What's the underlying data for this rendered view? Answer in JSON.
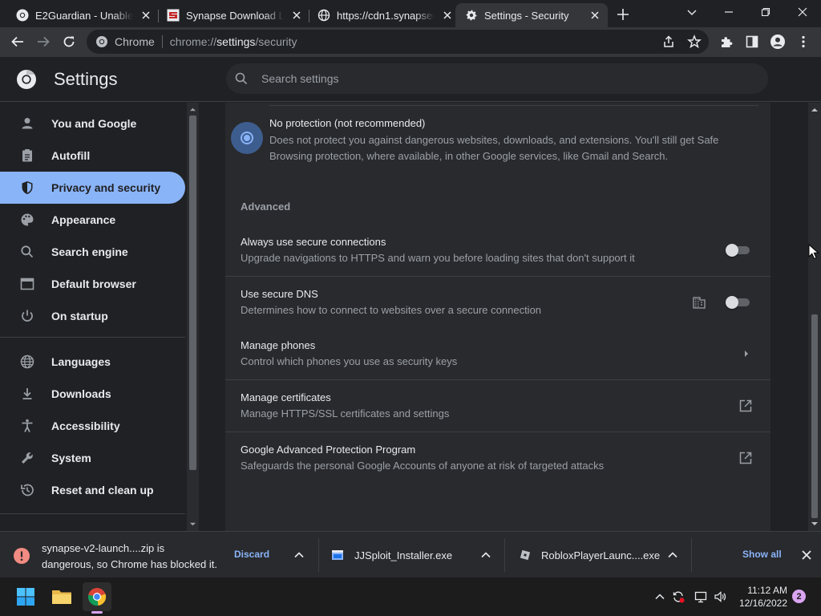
{
  "tabs": [
    {
      "title": "E2Guardian - Unable to",
      "favicon": "chrome-icon"
    },
    {
      "title": "Synapse Download Late",
      "favicon": "synapse-icon"
    },
    {
      "title": "https://cdn1.synapsecdn",
      "favicon": "globe-icon"
    },
    {
      "title": "Settings - Security",
      "favicon": "gear-icon"
    }
  ],
  "omnibox": {
    "site_label": "Chrome",
    "url_scheme": "chrome://",
    "url_host": "settings",
    "url_path": "/security"
  },
  "header": {
    "title": "Settings",
    "search_placeholder": "Search settings"
  },
  "sidebar": {
    "items": [
      {
        "label": "You and Google",
        "icon": "person-icon"
      },
      {
        "label": "Autofill",
        "icon": "clipboard-icon"
      },
      {
        "label": "Privacy and security",
        "icon": "shield-icon",
        "active": true
      },
      {
        "label": "Appearance",
        "icon": "palette-icon"
      },
      {
        "label": "Search engine",
        "icon": "search-icon"
      },
      {
        "label": "Default browser",
        "icon": "browser-icon"
      },
      {
        "label": "On startup",
        "icon": "power-icon"
      },
      {
        "label": "Languages",
        "icon": "globe-icon"
      },
      {
        "label": "Downloads",
        "icon": "download-icon"
      },
      {
        "label": "Accessibility",
        "icon": "accessibility-icon"
      },
      {
        "label": "System",
        "icon": "wrench-icon"
      },
      {
        "label": "Reset and clean up",
        "icon": "history-icon"
      }
    ]
  },
  "main": {
    "no_protection": {
      "title": "No protection (not recommended)",
      "description": "Does not protect you against dangerous websites, downloads, and extensions. You'll still get Safe Browsing protection, where available, in other Google services, like Gmail and Search.",
      "selected": true
    },
    "advanced_label": "Advanced",
    "rows": [
      {
        "title": "Always use secure connections",
        "description": "Upgrade navigations to HTTPS and warn you before loading sites that don't support it",
        "control": "toggle",
        "on": false
      },
      {
        "title": "Use secure DNS",
        "description": "Determines how to connect to websites over a secure connection",
        "control": "toggle",
        "on": false,
        "managed_icon": "enterprise-icon"
      },
      {
        "title": "Manage phones",
        "description": "Control which phones you use as security keys",
        "control": "chevron"
      },
      {
        "title": "Manage certificates",
        "description": "Manage HTTPS/SSL certificates and settings",
        "control": "external-link"
      },
      {
        "title": "Google Advanced Protection Program",
        "description": "Safeguards the personal Google Accounts of anyone at risk of targeted attacks",
        "control": "external-link"
      }
    ]
  },
  "downloads": {
    "blocked_line1": "synapse-v2-launch....zip is",
    "blocked_line2": "dangerous, so Chrome has blocked it.",
    "discard_label": "Discard",
    "items": [
      {
        "name": "JJSploit_Installer.exe"
      },
      {
        "name": "RobloxPlayerLaunc....exe"
      }
    ],
    "show_all_label": "Show all"
  },
  "taskbar": {
    "time": "11:12 AM",
    "date": "12/16/2022",
    "notification_count": "2"
  },
  "colors": {
    "accent": "#8ab4f8",
    "background": "#202124",
    "card": "#292a2d",
    "warning": "#f28b82"
  }
}
